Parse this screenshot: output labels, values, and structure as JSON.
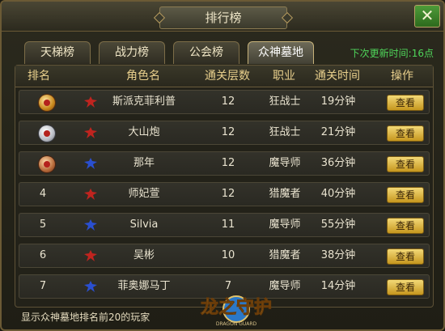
{
  "window": {
    "title": "排行榜",
    "close_label": "✕"
  },
  "tabs": [
    {
      "label": "天梯榜",
      "active": false
    },
    {
      "label": "战力榜",
      "active": false
    },
    {
      "label": "公会榜",
      "active": false
    },
    {
      "label": "众神墓地",
      "active": true
    }
  ],
  "next_update": "下次更新时间:16点",
  "table": {
    "headers": [
      "排名",
      "角色名",
      "通关层数",
      "职业",
      "通关时间",
      "操作"
    ],
    "rows": [
      {
        "rank": "",
        "medal": "gold",
        "faction": "red",
        "name": "斯派克菲利普",
        "floors": "12",
        "class": "狂战士",
        "time": "19分钟",
        "action": "查看"
      },
      {
        "rank": "",
        "medal": "silver",
        "faction": "red",
        "name": "大山炮",
        "floors": "12",
        "class": "狂战士",
        "time": "21分钟",
        "action": "查看"
      },
      {
        "rank": "",
        "medal": "bronze",
        "faction": "blue",
        "name": "那年",
        "floors": "12",
        "class": "魔导师",
        "time": "36分钟",
        "action": "查看"
      },
      {
        "rank": "4",
        "medal": "",
        "faction": "red",
        "name": "师妃萱",
        "floors": "12",
        "class": "猎魔者",
        "time": "40分钟",
        "action": "查看"
      },
      {
        "rank": "5",
        "medal": "",
        "faction": "blue",
        "name": "Silvia",
        "floors": "11",
        "class": "魔导师",
        "time": "55分钟",
        "action": "查看"
      },
      {
        "rank": "6",
        "medal": "",
        "faction": "red",
        "name": "吴彬",
        "floors": "10",
        "class": "猎魔者",
        "time": "38分钟",
        "action": "查看"
      },
      {
        "rank": "7",
        "medal": "",
        "faction": "blue",
        "name": "菲奥娜马丁",
        "floors": "7",
        "class": "魔导师",
        "time": "14分钟",
        "action": "查看"
      }
    ]
  },
  "footer": {
    "note": "显示众神墓地排名前20的玩家",
    "logo_text": "龙之守护",
    "logo_subtext": "DRAGON GUARD"
  },
  "colors": {
    "header_text": "#e8cf8c",
    "update_text": "#4fd65a",
    "button_gold": "#f3d977",
    "faction_red": "#c0241f",
    "faction_blue": "#2a4fd0"
  }
}
